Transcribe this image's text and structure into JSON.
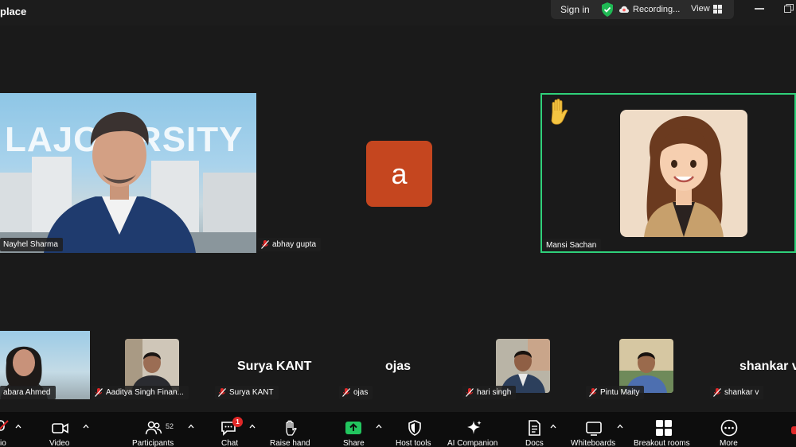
{
  "window": {
    "title": "place"
  },
  "topbar": {
    "sign_in": "Sign in",
    "recording": "Recording...",
    "view": "View",
    "colors": {
      "shield": "#1fb954",
      "recording": "#ff5c5c"
    }
  },
  "stage": {
    "speaker_banner_text": "LAJO   ERSITY",
    "participants_top": [
      {
        "name": "Nayhel Sharma"
      },
      {
        "name": "abhay gupta",
        "avatar_letter": "a"
      },
      {
        "name": "Mansi Sachan"
      }
    ],
    "participants_bottom": [
      {
        "name": "abara Ahmed"
      },
      {
        "name": "Aaditya Singh Finan..."
      },
      {
        "name": "Surya KANT",
        "display_text": "Surya KANT"
      },
      {
        "name": "ojas",
        "display_text": "ojas"
      },
      {
        "name": "hari singh"
      },
      {
        "name": "Pintu Maity"
      },
      {
        "name": "shankar v",
        "display_text": "shankar v"
      }
    ],
    "active_border_color": "#2fd07a"
  },
  "toolbar": {
    "audio": "io",
    "video": "Video",
    "participants": "Participants",
    "participants_count": "52",
    "chat": "Chat",
    "chat_badge": "1",
    "raise_hand": "Raise hand",
    "share": "Share",
    "host_tools": "Host tools",
    "ai_companion": "AI Companion",
    "docs": "Docs",
    "whiteboards": "Whiteboards",
    "breakout_rooms": "Breakout rooms",
    "more": "More",
    "colors": {
      "share": "#22c55e",
      "mute": "#e02828"
    }
  }
}
